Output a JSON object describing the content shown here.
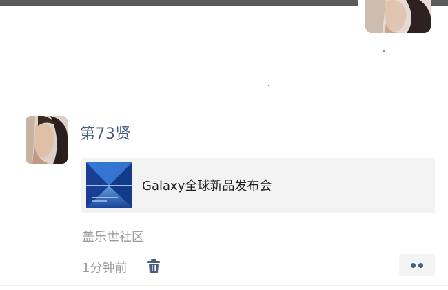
{
  "post": {
    "author": "第73贤",
    "link": {
      "title": "Galaxy全球新品发布会",
      "thumbnail_icon": "galaxy-event-thumbnail"
    },
    "source": "盖乐世社区",
    "time": "1分钟前",
    "delete_icon": "trash-icon",
    "more_icon": "more-dots-icon"
  },
  "colors": {
    "author_name": "#4a5e7e",
    "meta_text": "#9a9a9a",
    "card_bg": "#f3f3f3"
  }
}
